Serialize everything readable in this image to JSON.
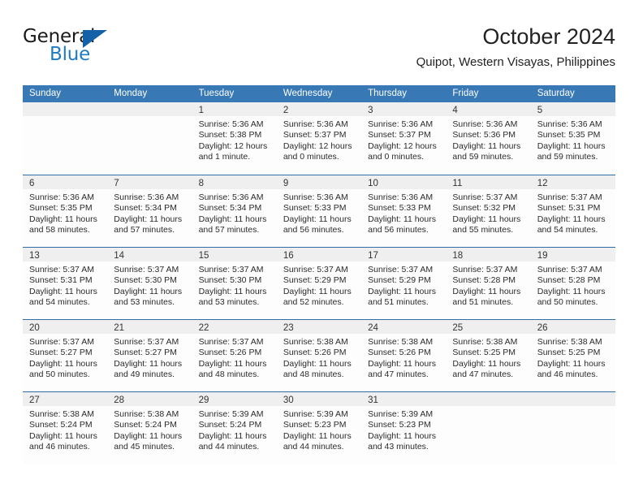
{
  "brand": {
    "word1": "General",
    "word2": "Blue",
    "logo_icon": "blue-triangle-logo"
  },
  "header": {
    "title": "October 2024",
    "subtitle": "Quipot, Western Visayas, Philippines"
  },
  "calendar": {
    "weekday_headers": [
      "Sunday",
      "Monday",
      "Tuesday",
      "Wednesday",
      "Thursday",
      "Friday",
      "Saturday"
    ],
    "accent_color": "#3878b4",
    "row_divider_color": "#2f6ca8",
    "daynum_bar_color": "#efefef",
    "weeks": [
      [
        {
          "day": "",
          "sunrise": "",
          "sunset": "",
          "daylight1": "",
          "daylight2": ""
        },
        {
          "day": "",
          "sunrise": "",
          "sunset": "",
          "daylight1": "",
          "daylight2": ""
        },
        {
          "day": "1",
          "sunrise": "Sunrise: 5:36 AM",
          "sunset": "Sunset: 5:38 PM",
          "daylight1": "Daylight: 12 hours",
          "daylight2": "and 1 minute."
        },
        {
          "day": "2",
          "sunrise": "Sunrise: 5:36 AM",
          "sunset": "Sunset: 5:37 PM",
          "daylight1": "Daylight: 12 hours",
          "daylight2": "and 0 minutes."
        },
        {
          "day": "3",
          "sunrise": "Sunrise: 5:36 AM",
          "sunset": "Sunset: 5:37 PM",
          "daylight1": "Daylight: 12 hours",
          "daylight2": "and 0 minutes."
        },
        {
          "day": "4",
          "sunrise": "Sunrise: 5:36 AM",
          "sunset": "Sunset: 5:36 PM",
          "daylight1": "Daylight: 11 hours",
          "daylight2": "and 59 minutes."
        },
        {
          "day": "5",
          "sunrise": "Sunrise: 5:36 AM",
          "sunset": "Sunset: 5:35 PM",
          "daylight1": "Daylight: 11 hours",
          "daylight2": "and 59 minutes."
        }
      ],
      [
        {
          "day": "6",
          "sunrise": "Sunrise: 5:36 AM",
          "sunset": "Sunset: 5:35 PM",
          "daylight1": "Daylight: 11 hours",
          "daylight2": "and 58 minutes."
        },
        {
          "day": "7",
          "sunrise": "Sunrise: 5:36 AM",
          "sunset": "Sunset: 5:34 PM",
          "daylight1": "Daylight: 11 hours",
          "daylight2": "and 57 minutes."
        },
        {
          "day": "8",
          "sunrise": "Sunrise: 5:36 AM",
          "sunset": "Sunset: 5:34 PM",
          "daylight1": "Daylight: 11 hours",
          "daylight2": "and 57 minutes."
        },
        {
          "day": "9",
          "sunrise": "Sunrise: 5:36 AM",
          "sunset": "Sunset: 5:33 PM",
          "daylight1": "Daylight: 11 hours",
          "daylight2": "and 56 minutes."
        },
        {
          "day": "10",
          "sunrise": "Sunrise: 5:36 AM",
          "sunset": "Sunset: 5:33 PM",
          "daylight1": "Daylight: 11 hours",
          "daylight2": "and 56 minutes."
        },
        {
          "day": "11",
          "sunrise": "Sunrise: 5:37 AM",
          "sunset": "Sunset: 5:32 PM",
          "daylight1": "Daylight: 11 hours",
          "daylight2": "and 55 minutes."
        },
        {
          "day": "12",
          "sunrise": "Sunrise: 5:37 AM",
          "sunset": "Sunset: 5:31 PM",
          "daylight1": "Daylight: 11 hours",
          "daylight2": "and 54 minutes."
        }
      ],
      [
        {
          "day": "13",
          "sunrise": "Sunrise: 5:37 AM",
          "sunset": "Sunset: 5:31 PM",
          "daylight1": "Daylight: 11 hours",
          "daylight2": "and 54 minutes."
        },
        {
          "day": "14",
          "sunrise": "Sunrise: 5:37 AM",
          "sunset": "Sunset: 5:30 PM",
          "daylight1": "Daylight: 11 hours",
          "daylight2": "and 53 minutes."
        },
        {
          "day": "15",
          "sunrise": "Sunrise: 5:37 AM",
          "sunset": "Sunset: 5:30 PM",
          "daylight1": "Daylight: 11 hours",
          "daylight2": "and 53 minutes."
        },
        {
          "day": "16",
          "sunrise": "Sunrise: 5:37 AM",
          "sunset": "Sunset: 5:29 PM",
          "daylight1": "Daylight: 11 hours",
          "daylight2": "and 52 minutes."
        },
        {
          "day": "17",
          "sunrise": "Sunrise: 5:37 AM",
          "sunset": "Sunset: 5:29 PM",
          "daylight1": "Daylight: 11 hours",
          "daylight2": "and 51 minutes."
        },
        {
          "day": "18",
          "sunrise": "Sunrise: 5:37 AM",
          "sunset": "Sunset: 5:28 PM",
          "daylight1": "Daylight: 11 hours",
          "daylight2": "and 51 minutes."
        },
        {
          "day": "19",
          "sunrise": "Sunrise: 5:37 AM",
          "sunset": "Sunset: 5:28 PM",
          "daylight1": "Daylight: 11 hours",
          "daylight2": "and 50 minutes."
        }
      ],
      [
        {
          "day": "20",
          "sunrise": "Sunrise: 5:37 AM",
          "sunset": "Sunset: 5:27 PM",
          "daylight1": "Daylight: 11 hours",
          "daylight2": "and 50 minutes."
        },
        {
          "day": "21",
          "sunrise": "Sunrise: 5:37 AM",
          "sunset": "Sunset: 5:27 PM",
          "daylight1": "Daylight: 11 hours",
          "daylight2": "and 49 minutes."
        },
        {
          "day": "22",
          "sunrise": "Sunrise: 5:37 AM",
          "sunset": "Sunset: 5:26 PM",
          "daylight1": "Daylight: 11 hours",
          "daylight2": "and 48 minutes."
        },
        {
          "day": "23",
          "sunrise": "Sunrise: 5:38 AM",
          "sunset": "Sunset: 5:26 PM",
          "daylight1": "Daylight: 11 hours",
          "daylight2": "and 48 minutes."
        },
        {
          "day": "24",
          "sunrise": "Sunrise: 5:38 AM",
          "sunset": "Sunset: 5:26 PM",
          "daylight1": "Daylight: 11 hours",
          "daylight2": "and 47 minutes."
        },
        {
          "day": "25",
          "sunrise": "Sunrise: 5:38 AM",
          "sunset": "Sunset: 5:25 PM",
          "daylight1": "Daylight: 11 hours",
          "daylight2": "and 47 minutes."
        },
        {
          "day": "26",
          "sunrise": "Sunrise: 5:38 AM",
          "sunset": "Sunset: 5:25 PM",
          "daylight1": "Daylight: 11 hours",
          "daylight2": "and 46 minutes."
        }
      ],
      [
        {
          "day": "27",
          "sunrise": "Sunrise: 5:38 AM",
          "sunset": "Sunset: 5:24 PM",
          "daylight1": "Daylight: 11 hours",
          "daylight2": "and 46 minutes."
        },
        {
          "day": "28",
          "sunrise": "Sunrise: 5:38 AM",
          "sunset": "Sunset: 5:24 PM",
          "daylight1": "Daylight: 11 hours",
          "daylight2": "and 45 minutes."
        },
        {
          "day": "29",
          "sunrise": "Sunrise: 5:39 AM",
          "sunset": "Sunset: 5:24 PM",
          "daylight1": "Daylight: 11 hours",
          "daylight2": "and 44 minutes."
        },
        {
          "day": "30",
          "sunrise": "Sunrise: 5:39 AM",
          "sunset": "Sunset: 5:23 PM",
          "daylight1": "Daylight: 11 hours",
          "daylight2": "and 44 minutes."
        },
        {
          "day": "31",
          "sunrise": "Sunrise: 5:39 AM",
          "sunset": "Sunset: 5:23 PM",
          "daylight1": "Daylight: 11 hours",
          "daylight2": "and 43 minutes."
        },
        {
          "day": "",
          "sunrise": "",
          "sunset": "",
          "daylight1": "",
          "daylight2": ""
        },
        {
          "day": "",
          "sunrise": "",
          "sunset": "",
          "daylight1": "",
          "daylight2": ""
        }
      ]
    ]
  }
}
